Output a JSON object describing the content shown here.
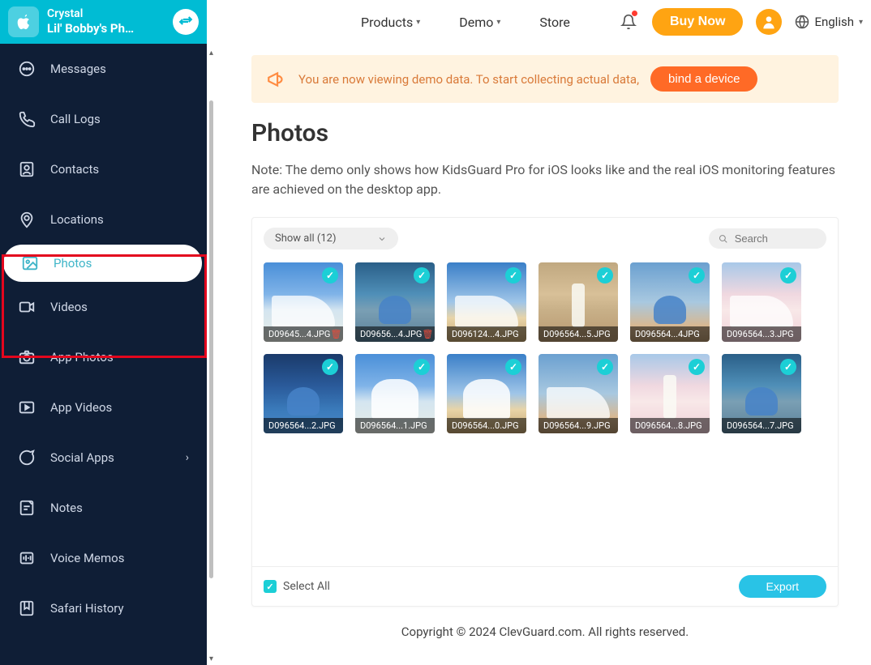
{
  "header": {
    "nav": {
      "products": "Products",
      "demo": "Demo",
      "store": "Store"
    },
    "buy_now": "Buy Now",
    "language": "English"
  },
  "sidebar": {
    "device": {
      "user": "Crystal",
      "phone": "Lil' Bobby's Pho..."
    },
    "items": [
      {
        "label": "Messages"
      },
      {
        "label": "Call Logs"
      },
      {
        "label": "Contacts"
      },
      {
        "label": "Locations"
      },
      {
        "label": "Photos"
      },
      {
        "label": "Videos"
      },
      {
        "label": "App Photos"
      },
      {
        "label": "App Videos"
      },
      {
        "label": "Social Apps",
        "expandable": true
      },
      {
        "label": "Notes"
      },
      {
        "label": "Voice Memos"
      },
      {
        "label": "Safari History"
      }
    ]
  },
  "banner": {
    "text": "You are now viewing demo data. To start collecting actual data, ",
    "button": "bind a device"
  },
  "page": {
    "title": "Photos",
    "note": "Note: The demo only shows how KidsGuard Pro for iOS looks like and the real iOS monitoring features are achieved on the desktop app."
  },
  "toolbar": {
    "filter": "Show all (12)",
    "search_placeholder": "Search"
  },
  "photos": [
    {
      "name": "D09645...4.JPG",
      "deletable": true
    },
    {
      "name": "D09656...4.JPG",
      "deletable": true
    },
    {
      "name": "D096124...4.JPG"
    },
    {
      "name": "D096564...5.JPG"
    },
    {
      "name": "D096564...4JPG"
    },
    {
      "name": "D096564...3.JPG"
    },
    {
      "name": "D096564...2.JPG"
    },
    {
      "name": "D096564...1.JPG"
    },
    {
      "name": "D096564...0.JPG"
    },
    {
      "name": "D096564...9.JPG"
    },
    {
      "name": "D096564...8.JPG"
    },
    {
      "name": "D096564...7.JPG"
    }
  ],
  "actions": {
    "select_all": "Select All",
    "export": "Export"
  },
  "footer": "Copyright © 2024 ClevGuard.com. All rights reserved."
}
